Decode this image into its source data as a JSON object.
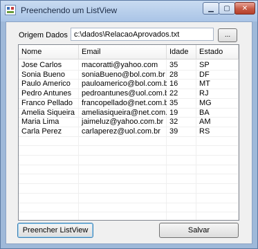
{
  "window": {
    "title": "Preenchendo um ListView",
    "controls": {
      "minimize": "▁",
      "maximize": "▢",
      "close": "✕"
    }
  },
  "form": {
    "origem_label": "Origem Dados :",
    "path_value": "c:\\dados\\RelacaoAprovados.txt",
    "browse_label": "..."
  },
  "listview": {
    "columns": [
      "Nome",
      "Email",
      "Idade",
      "Estado"
    ],
    "rows": [
      [
        "Jose Carlos",
        "macoratti@yahoo.com",
        "35",
        "SP"
      ],
      [
        "Sonia Bueno",
        "soniaBueno@bol.com.br",
        "28",
        "DF"
      ],
      [
        "Paulo Americo",
        "pauloamerico@bol.com.br",
        "16",
        "MT"
      ],
      [
        "Pedro Antunes",
        "pedroantunes@uol.com.br",
        "22",
        "RJ"
      ],
      [
        "Franco Pellado",
        "francopellado@net.com.br",
        "35",
        "MG"
      ],
      [
        "Amelia Siqueira",
        "ameliasiqueira@net.com.br",
        "19",
        "BA"
      ],
      [
        "Maria Lima",
        "jaimeluz@yahoo.com.br",
        "32",
        "AM"
      ],
      [
        "Carla Perez",
        "carlaperez@uol.com.br",
        "39",
        "RS"
      ]
    ]
  },
  "buttons": {
    "fill_label": "Preencher ListView",
    "save_label": "Salvar"
  }
}
